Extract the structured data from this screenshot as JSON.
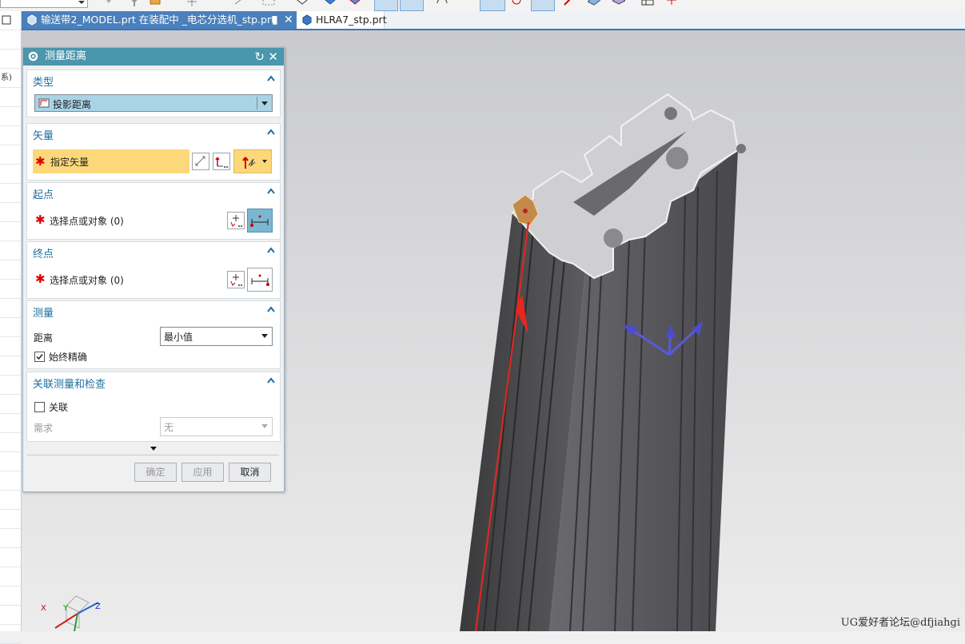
{
  "tabs": [
    {
      "label": "输送带2_MODEL.prt 在装配中 _电芯分选机_stp.prt",
      "close": "✕"
    },
    {
      "label": "HLRA7_stp.prt"
    }
  ],
  "left_strip": {
    "partial_text": "系)"
  },
  "dialog": {
    "title": "测量距离",
    "type_group": {
      "header": "类型",
      "selected": "投影距离"
    },
    "vector_group": {
      "header": "矢量",
      "label": "指定矢量"
    },
    "start_group": {
      "header": "起点",
      "label": "选择点或对象 (0)"
    },
    "end_group": {
      "header": "终点",
      "label": "选择点或对象 (0)"
    },
    "measure_group": {
      "header": "测量",
      "distance_label": "距离",
      "distance_value": "最小值",
      "always_accurate": "始终精确",
      "always_accurate_checked": true
    },
    "assoc_group": {
      "header": "关联测量和检查",
      "associative": "关联",
      "associative_checked": false,
      "requirement_label": "需求",
      "requirement_value": "无"
    },
    "buttons": {
      "ok": "确定",
      "apply": "应用",
      "cancel": "取消"
    }
  },
  "triad": {
    "x": "X",
    "y": "Y",
    "z": "Z"
  },
  "watermark": "UG爱好者论坛@dfjiahgi",
  "colors": {
    "title_bar": "#4a96ac",
    "group_header": "#1f6fa0",
    "required_highlight": "#fcd87a",
    "tab_active": "#4a80bb",
    "vector_arrow": "#e8261e",
    "csys_arrows": "#5a5ad8"
  }
}
